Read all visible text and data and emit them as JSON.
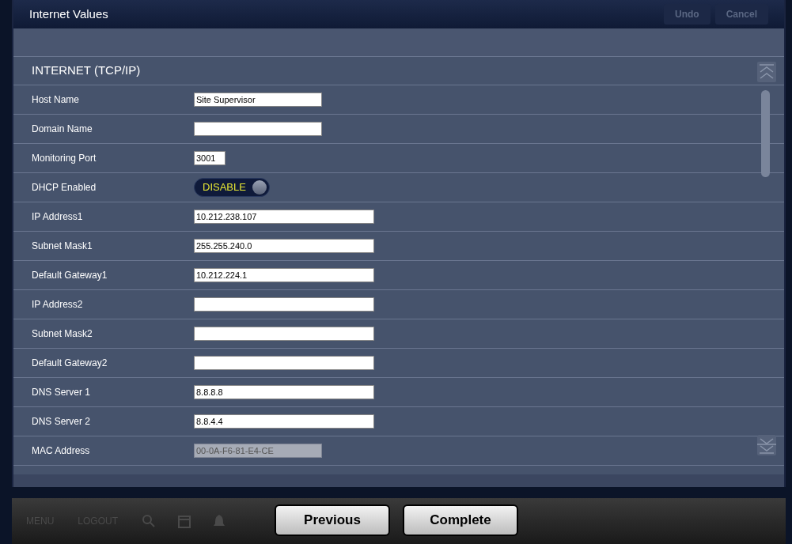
{
  "window": {
    "title": "Internet Values"
  },
  "header_buttons": [
    {
      "label": "Undo",
      "disabled": true
    },
    {
      "label": "Cancel",
      "disabled": true
    }
  ],
  "section": {
    "title": "INTERNET (TCP/IP)"
  },
  "fields": [
    {
      "label": "Host Name",
      "kind": "name_field",
      "value": "Site Supervisor",
      "disabled": false
    },
    {
      "label": "Domain Name",
      "kind": "name_field",
      "disabled": false
    },
    {
      "label": "Monitoring Port",
      "kind": "port_field",
      "value": "3001",
      "disabled": false
    },
    {
      "label": "DHCP Enabled",
      "kind": "toggle",
      "on": false,
      "text": "DISABLE"
    },
    {
      "label": "IP Address1",
      "kind": "address_field",
      "value": "10.212.238.107",
      "disabled": false
    },
    {
      "label": "Subnet Mask1",
      "kind": "address_field",
      "value": "255.255.240.0",
      "disabled": false
    },
    {
      "label": "Default Gateway1",
      "kind": "address_field",
      "value": "10.212.224.1",
      "disabled": false
    },
    {
      "label": "IP Address2",
      "kind": "address_field",
      "disabled": false
    },
    {
      "label": "Subnet Mask2",
      "kind": "address_field",
      "disabled": false
    },
    {
      "label": "Default Gateway2",
      "kind": "address_field",
      "disabled": false
    },
    {
      "label": "DNS Server 1",
      "kind": "address_field",
      "value": "8.8.8.8",
      "disabled": false
    },
    {
      "label": "DNS Server 2",
      "kind": "address_field",
      "value": "8.8.4.4",
      "disabled": false
    },
    {
      "label": "MAC Address",
      "kind": "name_field",
      "value": "00-0A-F6-81-E4-CE",
      "disabled": true
    }
  ],
  "taskbar": {
    "items": [
      "MENU",
      "LOGOUT"
    ]
  },
  "wizard_buttons": [
    "Previous",
    "Complete"
  ]
}
